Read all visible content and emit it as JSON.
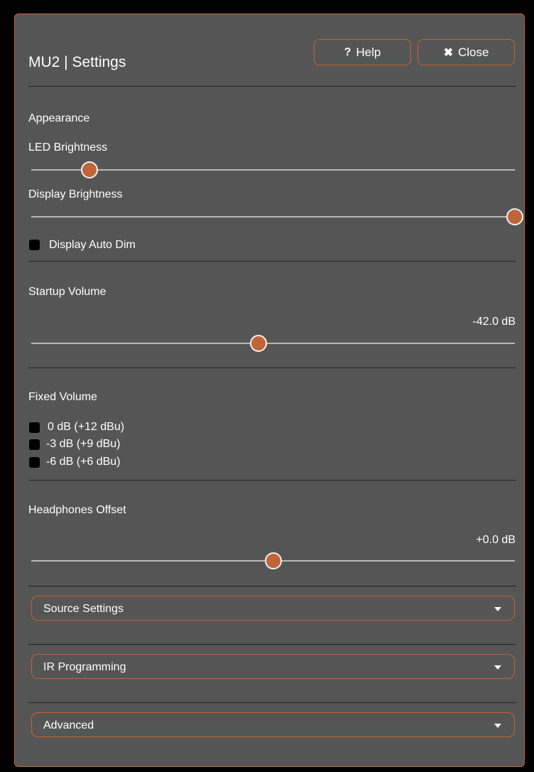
{
  "header": {
    "title": "MU2 | Settings",
    "help_label": "Help",
    "close_label": "Close"
  },
  "appearance": {
    "heading": "Appearance",
    "led_brightness_label": "LED Brightness",
    "led_brightness_level": 0.12,
    "display_brightness_label": "Display Brightness",
    "display_brightness_level": 1.0,
    "auto_dim_label": "Display Auto Dim",
    "auto_dim_checked": false
  },
  "startup_volume": {
    "heading": "Startup Volume",
    "value_text": "-42.0 dB",
    "level": 0.47
  },
  "fixed_volume": {
    "heading": "Fixed Volume",
    "options": [
      {
        "label": "0 dB (+12 dBu)",
        "checked": false
      },
      {
        "label": "-3 dB (+9 dBu)",
        "checked": false
      },
      {
        "label": "-6 dB (+6 dBu)",
        "checked": false
      }
    ]
  },
  "headphones_offset": {
    "heading": "Headphones Offset",
    "value_text": "+0.0 dB",
    "level": 0.5
  },
  "sections": {
    "source_settings": "Source Settings",
    "ir_programming": "IR Programming",
    "advanced": "Advanced"
  },
  "icons": {
    "help": "question-icon",
    "close": "x-icon",
    "dropdown": "caret-down-icon"
  },
  "colors": {
    "accent": "#c9612a",
    "panel": "#555555",
    "thumb": "#c0643a"
  }
}
